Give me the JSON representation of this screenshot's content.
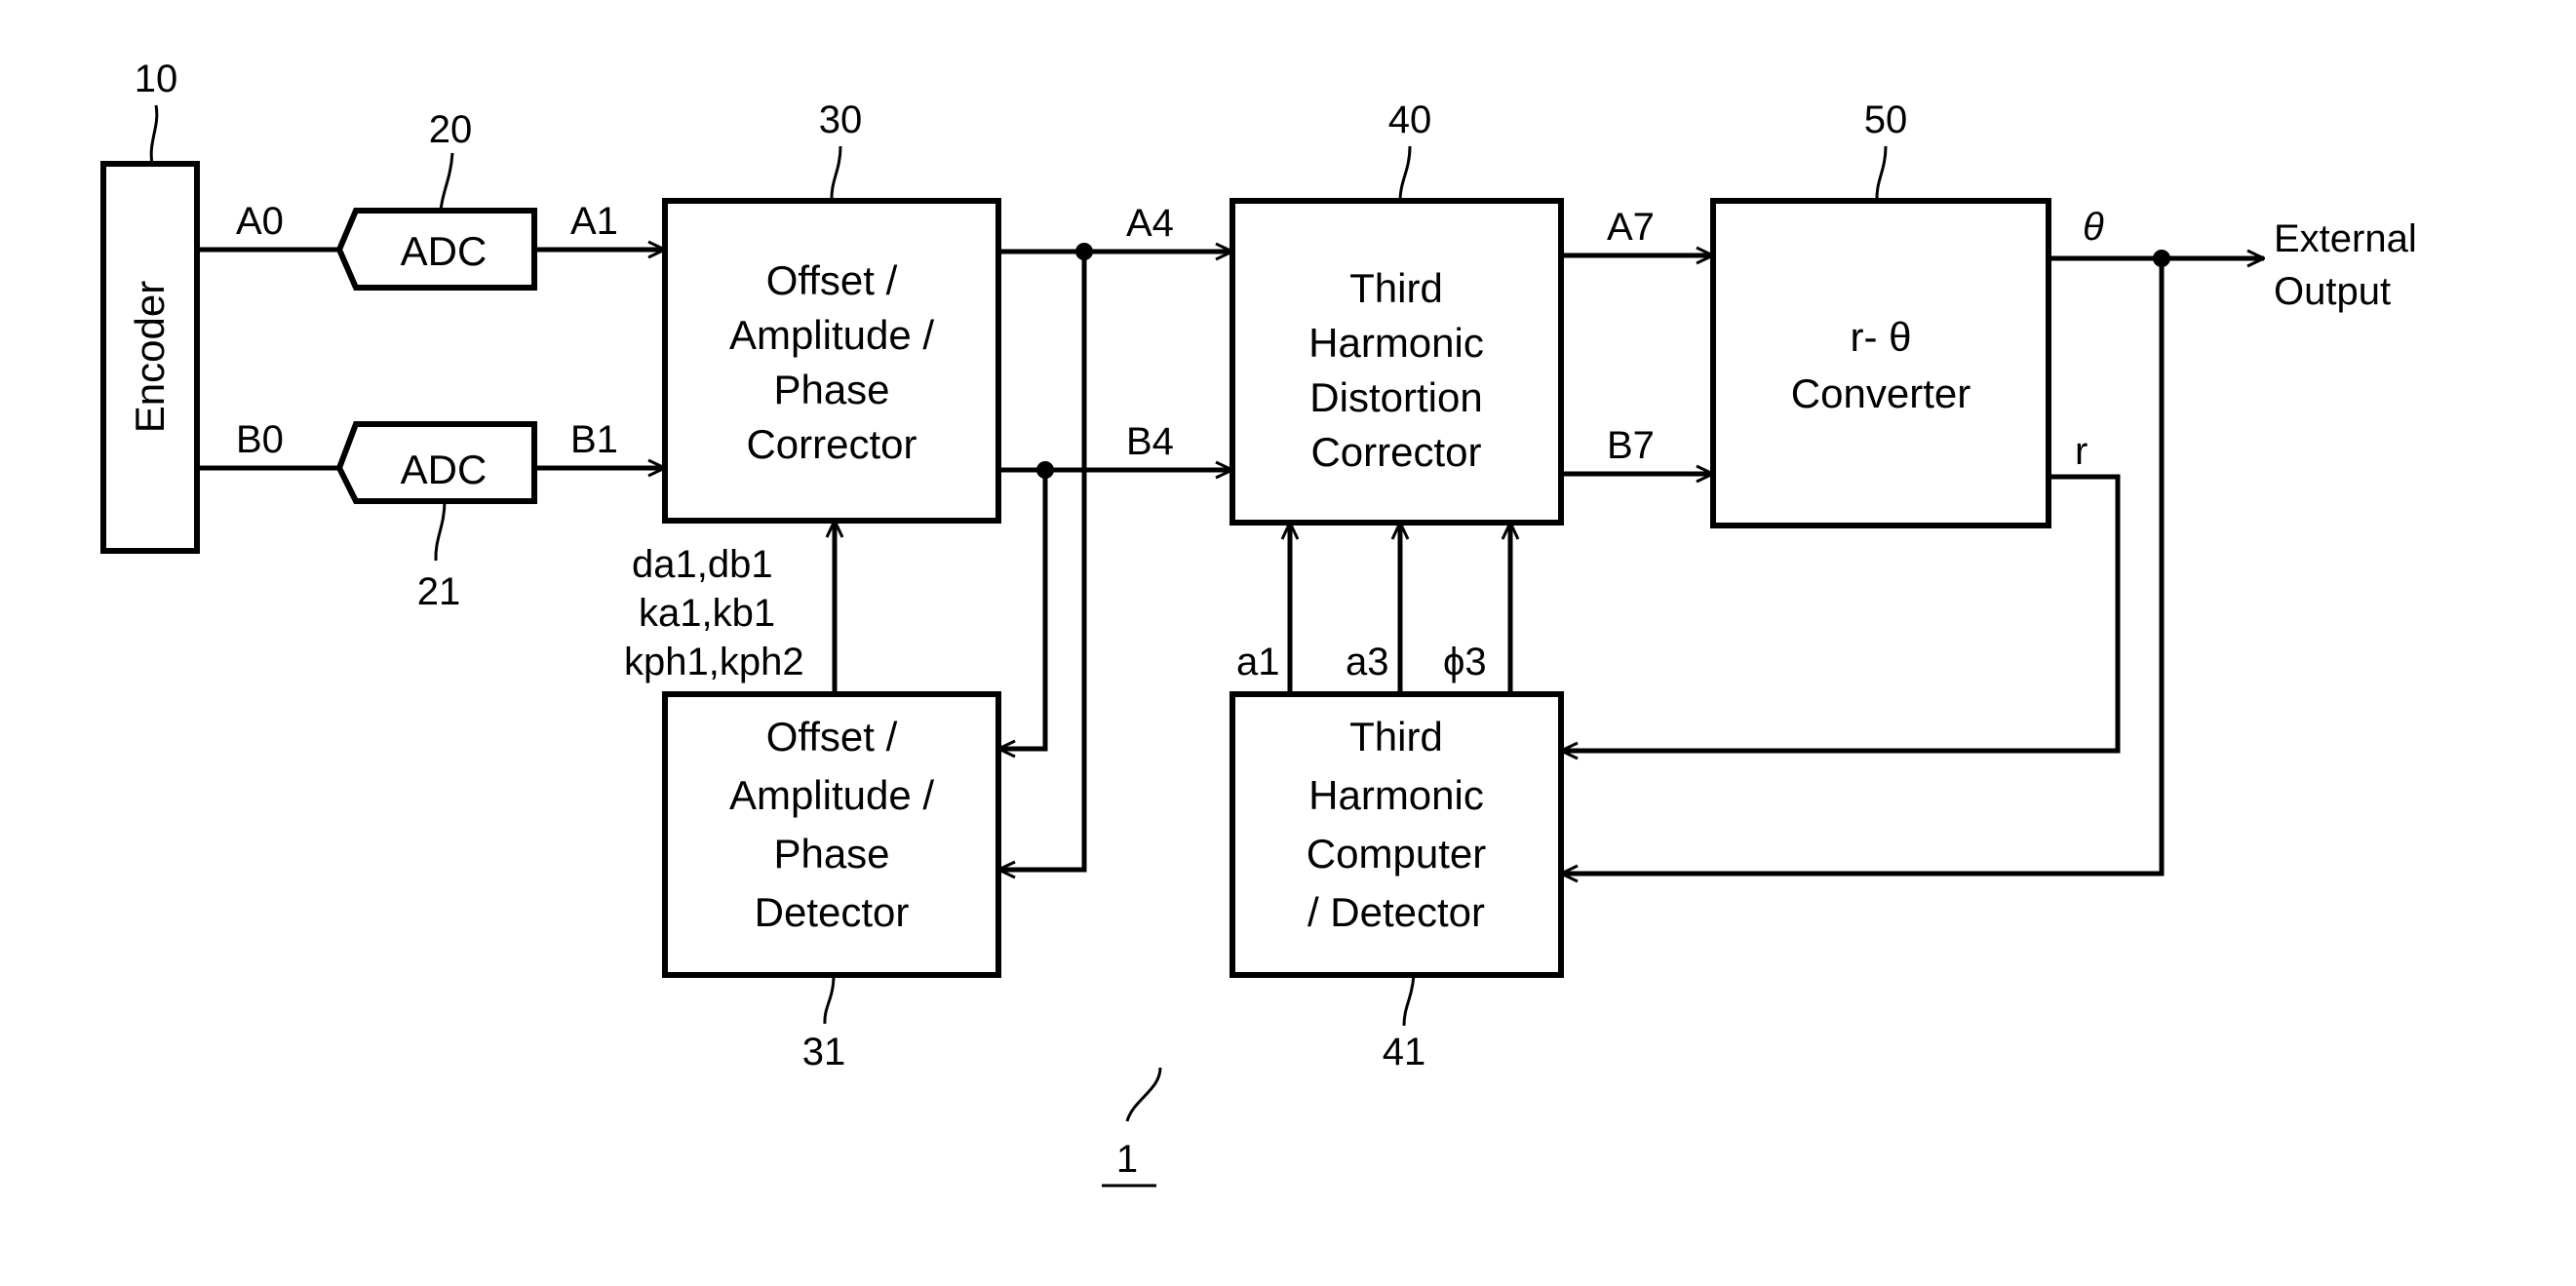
{
  "figure": {
    "number": "1",
    "blocks": {
      "encoder": {
        "ref": "10",
        "label": "Encoder"
      },
      "adc_a": {
        "ref": "20",
        "label": "ADC"
      },
      "adc_b": {
        "ref": "21",
        "label": "ADC"
      },
      "corrector_oap": {
        "ref": "30",
        "lines": [
          "Offset /",
          "Amplitude /",
          "Phase",
          "Corrector"
        ]
      },
      "detector_oap": {
        "ref": "31",
        "lines": [
          "Offset /",
          "Amplitude /",
          "Phase",
          "Detector"
        ]
      },
      "corrector_thd": {
        "ref": "40",
        "lines": [
          "Third",
          "Harmonic",
          "Distortion",
          "Corrector"
        ]
      },
      "computer_thd": {
        "ref": "41",
        "lines": [
          "Third",
          "Harmonic",
          "Computer",
          "/ Detector"
        ]
      },
      "converter": {
        "ref": "50",
        "lines": [
          "r- θ",
          "Converter"
        ]
      }
    },
    "signals": {
      "a0": "A0",
      "b0": "B0",
      "a1": "A1",
      "b1": "B1",
      "a4": "A4",
      "b4": "B4",
      "a7": "A7",
      "b7": "B7",
      "theta": "θ",
      "r": "r",
      "coef_a1": "a1",
      "coef_a3": "a3",
      "coef_phi3": "ϕ3",
      "params": [
        "da1,db1",
        "ka1,kb1",
        "kph1,kph2"
      ]
    },
    "external_output": [
      "External",
      "Output"
    ]
  }
}
